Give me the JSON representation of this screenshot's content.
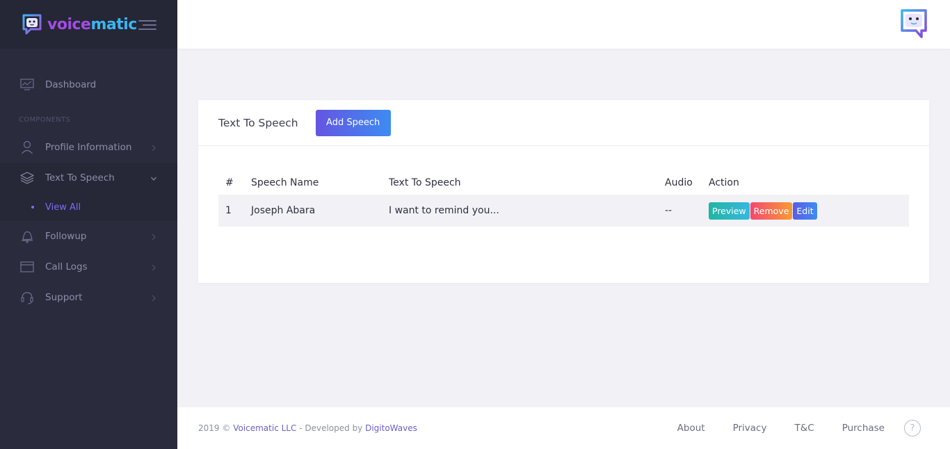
{
  "brand": {
    "name_part1": "voice",
    "name_part2": "matic",
    "logo_icon": "voicematic-bot-logo"
  },
  "sidebar": {
    "dashboard": {
      "label": "Dashboard",
      "icon": "monitor-chart-icon"
    },
    "section_label": "COMPONENTS",
    "items": [
      {
        "label": "Profile Information",
        "icon": "user-icon"
      },
      {
        "label": "Text To Speech",
        "icon": "layers-icon",
        "expanded": true,
        "sub": [
          {
            "label": "View All"
          }
        ]
      },
      {
        "label": "Followup",
        "icon": "bell-icon"
      },
      {
        "label": "Call Logs",
        "icon": "window-icon"
      },
      {
        "label": "Support",
        "icon": "headset-icon"
      }
    ]
  },
  "card": {
    "title": "Text To Speech",
    "add_button": "Add Speech",
    "table": {
      "headers": [
        "#",
        "Speech Name",
        "Text To Speech",
        "Audio",
        "Action"
      ],
      "rows": [
        {
          "num": "1",
          "name": "Joseph Abara",
          "text": "I want to remind you...",
          "audio": "--"
        }
      ],
      "actions": {
        "preview": "Preview",
        "remove": "Remove",
        "edit": "Edit"
      }
    }
  },
  "footer": {
    "year": "2019 ©",
    "company": "Voicematic LLC",
    "dev_prefix": "- Developed by",
    "developer": "DigitoWaves",
    "links": [
      "About",
      "Privacy",
      "T&C",
      "Purchase"
    ],
    "help": "?"
  },
  "colors": {
    "sidebar_bg": "#2a2b3d",
    "accent": "#7c6df2",
    "page_bg": "#f1f1f6"
  }
}
